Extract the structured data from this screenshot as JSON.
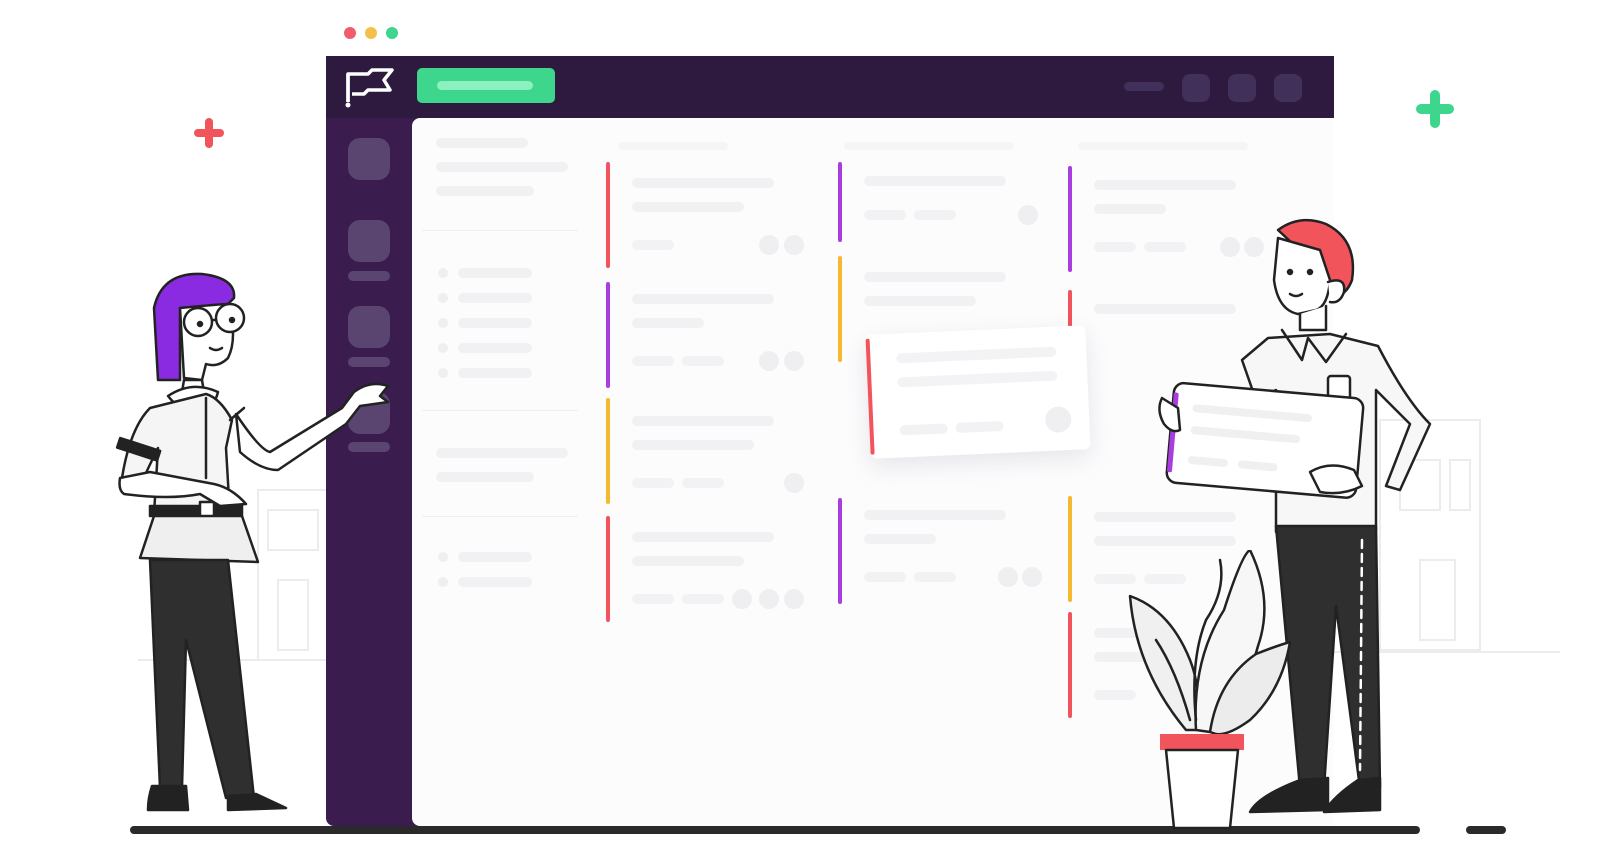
{
  "colors": {
    "window_dark": "#2d1a3e",
    "sidebar": "#3a1d4e",
    "accent_green": "#3dd68c",
    "accent_red": "#f2545b",
    "accent_purple": "#a93ee0",
    "accent_yellow": "#f5b82e",
    "traffic_red": "#f25c6a",
    "traffic_yellow": "#f5c04a",
    "traffic_green": "#3dd68c"
  },
  "icons": {
    "logo": "flag-icon",
    "decor_left": "plus-red-icon",
    "decor_right": "plus-green-icon"
  },
  "columns": [
    {
      "name": "column-1",
      "cards": [
        {
          "accent": "#f2545b"
        },
        {
          "accent": "#a93ee0"
        },
        {
          "accent": "#f5b82e"
        },
        {
          "accent": "#f2545b"
        }
      ]
    },
    {
      "name": "column-2",
      "cards": [
        {
          "accent": "#a93ee0"
        },
        {
          "accent": "#f5b82e"
        },
        {
          "accent": "#a93ee0"
        }
      ]
    },
    {
      "name": "column-3",
      "cards": [
        {
          "accent": "#a93ee0"
        },
        {
          "accent": "#f2545b"
        },
        {
          "accent": "#f5b82e"
        },
        {
          "accent": "#f2545b"
        }
      ]
    }
  ]
}
